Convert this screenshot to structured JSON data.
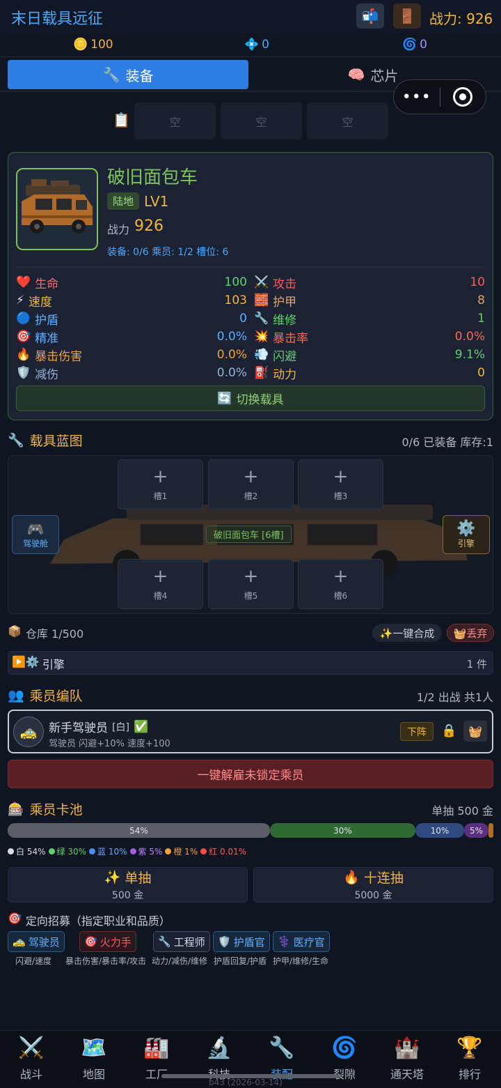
{
  "header": {
    "title": "末日载具远征",
    "mail_icon": "📬",
    "door_icon": "🚪",
    "power_label": "战力: 926"
  },
  "currencies": [
    {
      "icon": "🪙",
      "value": "100",
      "color": "#f3b53c"
    },
    {
      "icon": "💠",
      "value": "0",
      "color": "#4aa8ff"
    },
    {
      "icon": "🌀",
      "value": "0",
      "color": "#a98cff"
    }
  ],
  "tabs": [
    {
      "icon": "🔧",
      "label": "装备",
      "active": true
    },
    {
      "icon": "🧠",
      "label": "芯片",
      "active": false
    }
  ],
  "mini_program": {
    "more": "•••"
  },
  "loadout": {
    "icon": "📋",
    "slots": [
      "空",
      "空",
      "空"
    ]
  },
  "vehicle": {
    "name": "破旧面包车",
    "terrain": "陆地",
    "level": "LV1",
    "power_label": "战力",
    "power": "926",
    "meta": "装备: 0/6   乘员: 1/2   槽位: 6",
    "stats_left": [
      {
        "icon": "❤️",
        "label": "生命",
        "value": "100",
        "color": "#5fd16a"
      },
      {
        "icon": "⚡",
        "label": "速度",
        "value": "103",
        "color": "#f3b53c"
      },
      {
        "icon": "🔵",
        "label": "护盾",
        "value": "0",
        "color": "#5fb0ff"
      },
      {
        "icon": "🎯",
        "label": "精准",
        "value": "0.0%",
        "color": "#5fb0ff"
      },
      {
        "icon": "🔥",
        "label": "暴击伤害",
        "value": "0.0%",
        "color": "#f3a23c"
      },
      {
        "icon": "🛡️",
        "label": "减伤",
        "value": "0.0%",
        "color": "#9ab0d6"
      }
    ],
    "stats_right": [
      {
        "icon": "⚔️",
        "label": "攻击",
        "value": "10",
        "color": "#ff5c5c"
      },
      {
        "icon": "🧱",
        "label": "护甲",
        "value": "8",
        "color": "#e2a46b"
      },
      {
        "icon": "🔧",
        "label": "维修",
        "value": "1",
        "color": "#5fd16a"
      },
      {
        "icon": "💥",
        "label": "暴击率",
        "value": "0.0%",
        "color": "#ff6b4a"
      },
      {
        "icon": "💨",
        "label": "闪避",
        "value": "9.1%",
        "color": "#5fd16a"
      },
      {
        "icon": "⛽",
        "label": "动力",
        "value": "0",
        "color": "#f3b53c"
      }
    ],
    "switch_label": "切换载具",
    "switch_icon": "🔄"
  },
  "blueprint": {
    "title": "载具蓝图",
    "title_icon": "🔧",
    "status": "0/6 已装备   库存:1",
    "slots": [
      "槽1",
      "槽2",
      "槽3",
      "槽4",
      "槽5",
      "槽6"
    ],
    "cockpit_icon": "🎮",
    "cockpit_label": "驾驶舱",
    "engine_icon": "⚙️",
    "engine_label": "引擎",
    "center_label": "破旧面包车 [6槽]"
  },
  "warehouse": {
    "icon": "📦",
    "title": "仓库 1/500",
    "merge_label": "✨一键合成",
    "discard_label": "🧺丢弃",
    "filter_icons": "▶️⚙️",
    "filter_label": "引擎",
    "filter_count": "1 件"
  },
  "crew": {
    "icon": "👥",
    "title": "乘员编队",
    "status": "1/2 出战   共1人",
    "member": {
      "avatar_icon": "🚕",
      "name": "新手驾驶员",
      "grade": "[白]",
      "check": "✅",
      "desc": "驾驶员   闪避+10% 速度+100",
      "dismiss_label": "下阵",
      "lock_icon": "🔒",
      "trash_icon": "🧺"
    },
    "fire_all_label": "一键解雇未锁定乘员"
  },
  "gacha": {
    "icon": "🎰",
    "title": "乘员卡池",
    "price": "单抽 500 金",
    "bars": [
      {
        "pct": 54,
        "label": "54%",
        "color": "#5a5f66"
      },
      {
        "pct": 30,
        "label": "30%",
        "color": "#2e6a32"
      },
      {
        "pct": 10,
        "label": "10%",
        "color": "#2e4a80"
      },
      {
        "pct": 5,
        "label": "5%",
        "color": "#5a2e80"
      },
      {
        "pct": 1,
        "label": "",
        "color": "#b07020"
      }
    ],
    "legend": [
      {
        "dot": "#d8dde4",
        "text": "白 54%",
        "color": "#d8dde4"
      },
      {
        "dot": "#5fd16a",
        "text": "绿 30%",
        "color": "#5fd16a"
      },
      {
        "dot": "#4a8eff",
        "text": "蓝 10%",
        "color": "#6aa6ff"
      },
      {
        "dot": "#a25fe0",
        "text": "紫 5%",
        "color": "#b985ff"
      },
      {
        "dot": "#f3a23c",
        "text": "橙 1%",
        "color": "#f3a23c"
      },
      {
        "dot": "#ff4a4a",
        "text": "红 0.01%",
        "color": "#ff5c5c"
      }
    ],
    "single": {
      "icon": "✨",
      "label": "单抽",
      "cost": "500 金"
    },
    "ten": {
      "icon": "🔥",
      "label": "十连抽",
      "cost": "5000 金"
    }
  },
  "recruit": {
    "icon": "🎯",
    "title": "定向招募（指定职业和品质）",
    "jobs": [
      {
        "icon": "🚕",
        "label": "驾驶员",
        "sub": "闪避/速度",
        "color": "#5fb0ff",
        "border": "#2d5a8a"
      },
      {
        "icon": "🎯",
        "label": "火力手",
        "sub": "暴击伤害/暴击率/攻击",
        "color": "#ff5c5c",
        "border": "#7a2a2f"
      },
      {
        "icon": "🔧",
        "label": "工程师",
        "sub": "动力/减伤/维修",
        "color": "#d6dbe4",
        "border": "#445066"
      },
      {
        "icon": "🛡️",
        "label": "护盾官",
        "sub": "护盾回复/护盾",
        "color": "#5fb0ff",
        "border": "#2d5a8a"
      },
      {
        "icon": "⚕️",
        "label": "医疗官",
        "sub": "护甲/维修/生命",
        "color": "#5fb0ff",
        "border": "#2d5a8a"
      }
    ]
  },
  "nav": [
    {
      "icon": "⚔️",
      "label": "战斗",
      "active": false
    },
    {
      "icon": "🗺️",
      "label": "地图",
      "active": false
    },
    {
      "icon": "🏭",
      "label": "工厂",
      "active": false
    },
    {
      "icon": "🔬",
      "label": "科技",
      "active": false
    },
    {
      "icon": "🔧",
      "label": "装配",
      "active": true
    },
    {
      "icon": "🌀",
      "label": "裂隙",
      "active": false
    },
    {
      "icon": "🏰",
      "label": "通天塔",
      "active": false
    },
    {
      "icon": "🏆",
      "label": "排行",
      "active": false
    }
  ],
  "build": "b43 (2026-03-14)"
}
